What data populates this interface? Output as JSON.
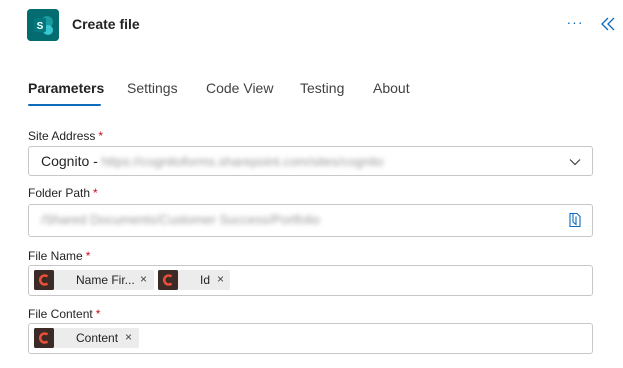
{
  "header": {
    "title": "Create file",
    "app_icon": "sharepoint-icon",
    "app_icon_letter": "S",
    "more_label": "···",
    "collapse_icon": "double-chevron-left-icon",
    "accent": "#0f6cbd",
    "brand_color": "#036c70"
  },
  "tabs": [
    {
      "label": "Parameters",
      "active": true
    },
    {
      "label": "Settings",
      "active": false
    },
    {
      "label": "Code View",
      "active": false
    },
    {
      "label": "Testing",
      "active": false
    },
    {
      "label": "About",
      "active": false
    }
  ],
  "fields": {
    "required_mark": "*",
    "site_address": {
      "label": "Site Address",
      "value_prefix": "Cognito -",
      "value_blurred": "https://cognitoforms.sharepoint.com/sites/cognito",
      "control_icon": "chevron-down-icon"
    },
    "folder_path": {
      "label": "Folder Path",
      "value_blurred": "/Shared Documents/Customer Success/Portfolio",
      "control_icon": "folder-picker-icon"
    },
    "file_name": {
      "label": "File Name",
      "tokens": [
        {
          "label": "Name Fir...",
          "icon": "cognito-forms-icon",
          "remove": "×"
        },
        {
          "label": "Id",
          "icon": "cognito-forms-icon",
          "remove": "×"
        }
      ]
    },
    "file_content": {
      "label": "File Content",
      "tokens": [
        {
          "label": "Content",
          "icon": "cognito-forms-icon",
          "remove": "×"
        }
      ]
    }
  }
}
